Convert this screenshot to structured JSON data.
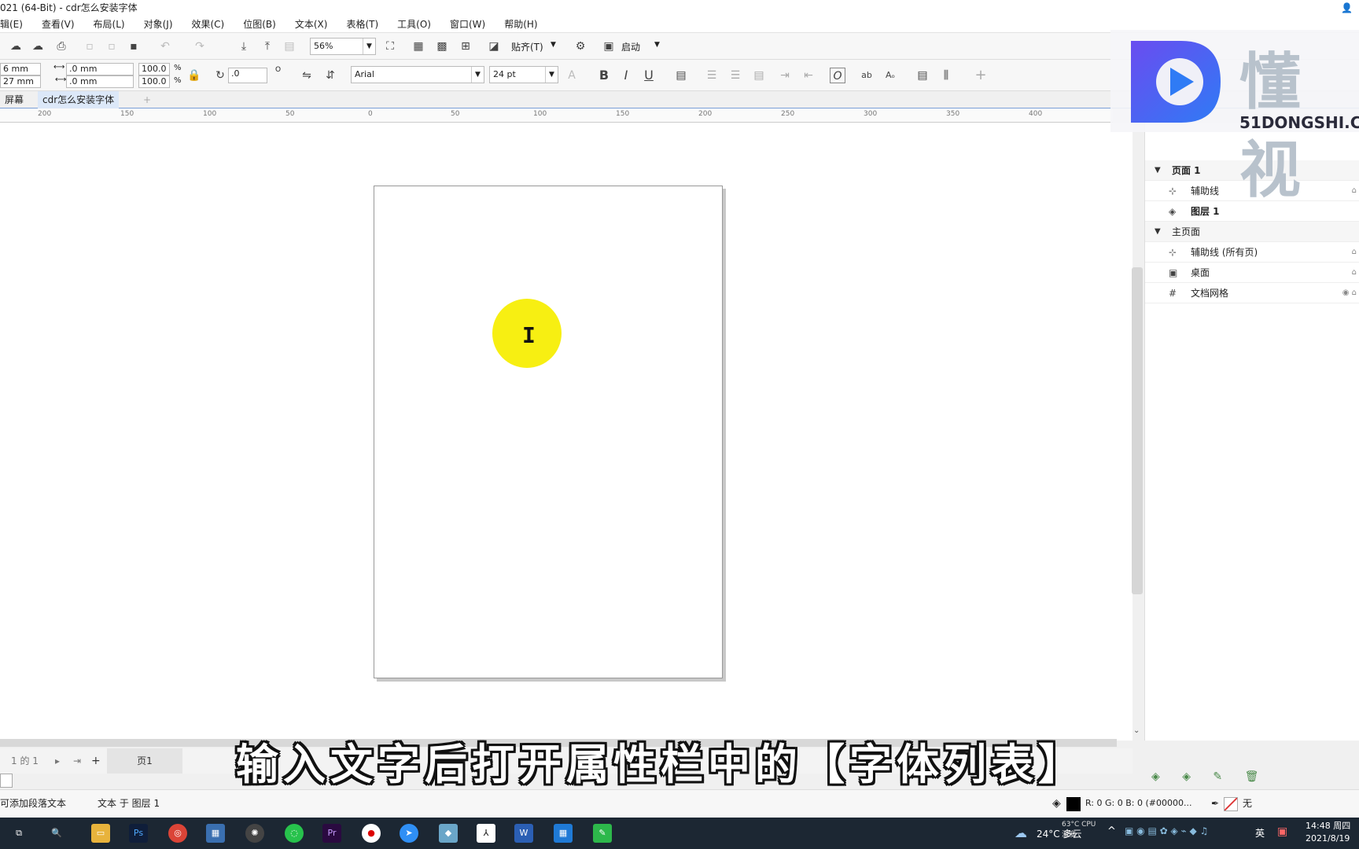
{
  "window": {
    "title": "021 (64-Bit) - cdr怎么安装字体"
  },
  "menu": [
    "辑(E)",
    "查看(V)",
    "布局(L)",
    "对象(J)",
    "效果(C)",
    "位图(B)",
    "文本(X)",
    "表格(T)",
    "工具(O)",
    "窗口(W)",
    "帮助(H)"
  ],
  "toolbar1": {
    "zoom": "56%",
    "snap_label": "贴齐(T)",
    "launch_label": "启动"
  },
  "toolbar2": {
    "x": "6 mm",
    "y": "27 mm",
    "w": ".0 mm",
    "h": ".0 mm",
    "scale_x": "100.0",
    "scale_y": "100.0",
    "pct": "%",
    "rotation": ".0",
    "degree": "O",
    "font": "Arial",
    "size": "24 pt",
    "bold": "B",
    "italic": "I",
    "underline": "U",
    "plus": "+"
  },
  "tabs": {
    "welcome": "屏幕",
    "doc": "cdr怎么安装字体",
    "add": "+"
  },
  "ruler_ticks": [
    "200",
    "150",
    "100",
    "50",
    "0",
    "50",
    "100",
    "150",
    "200",
    "250",
    "300",
    "350",
    "400"
  ],
  "panel": {
    "rows": [
      {
        "label": "页面 1",
        "arrow": "▼",
        "level": "top",
        "bold": true
      },
      {
        "label": "辅助线",
        "icon": "⊹",
        "lock": "⌂"
      },
      {
        "label": "图层 1",
        "icon": "◈",
        "bold": true
      },
      {
        "label": "主页面",
        "arrow": "▼",
        "level": "top"
      },
      {
        "label": "辅助线 (所有页)",
        "icon": "⊹",
        "lock": "⌂"
      },
      {
        "label": "桌面",
        "icon": "▣",
        "lock": "⌂"
      },
      {
        "label": "文档网格",
        "icon": "#",
        "lock": "◉ ⌂"
      }
    ]
  },
  "logo": {
    "text": "懂 视",
    "url": "51DONGSHI.C"
  },
  "pagebar": {
    "counter": "1 的 1",
    "page_tab": "页1",
    "add": "+"
  },
  "status": {
    "hint": "可添加段落文本",
    "object": "文本 于 图层 1",
    "color": "R: 0 G: 0 B: 0 (#00000...",
    "fill": "无"
  },
  "subtitle": "输入文字后打开属性栏中的【字体列表】",
  "taskbar": {
    "weather": "24°C 多云",
    "temp": "63°C CPU温度",
    "ime": "英",
    "time": "14:48 周四",
    "date": "2021/8/19"
  },
  "colors": {
    "accent": "#7aa0d8",
    "highlight": "#f7ef12",
    "taskbar": "#1c2733"
  }
}
